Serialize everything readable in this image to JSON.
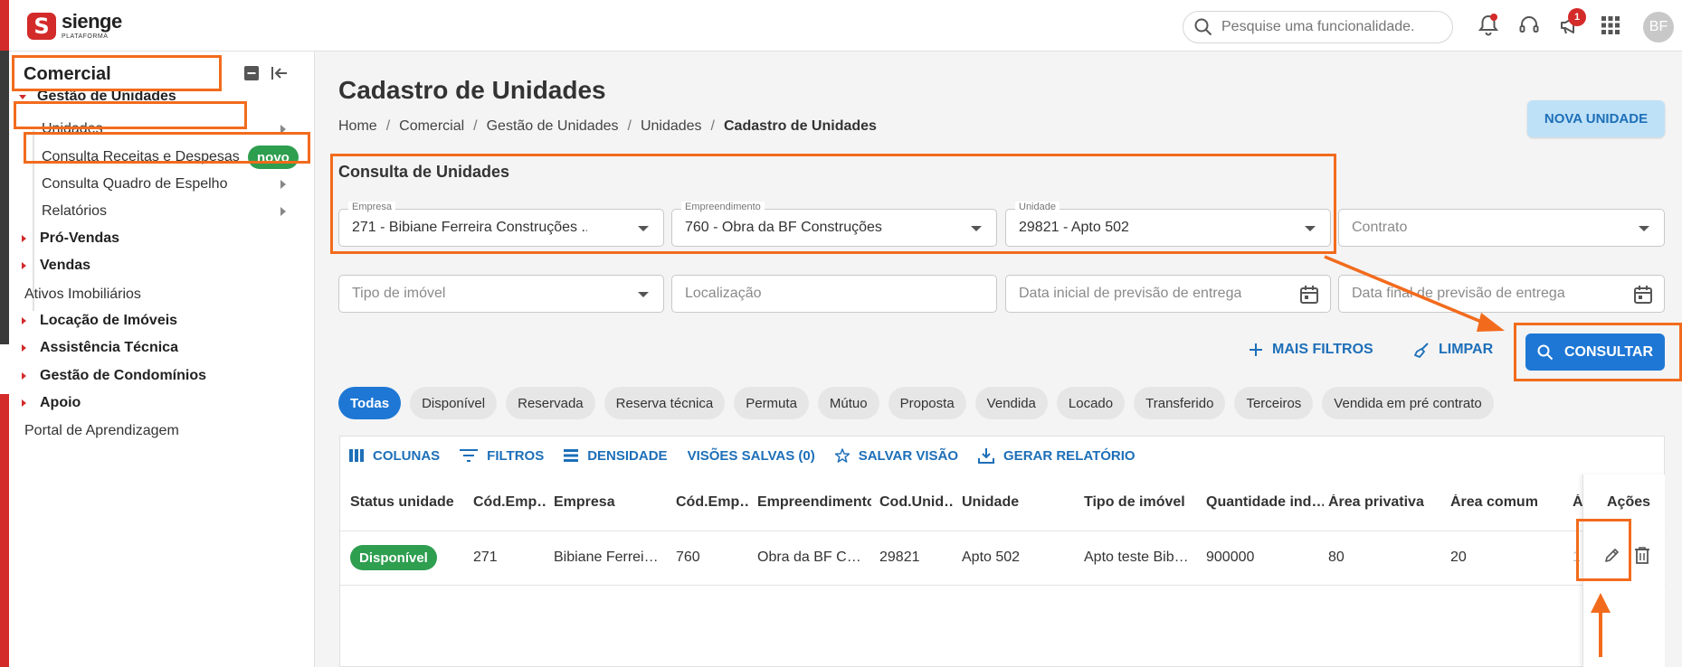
{
  "app": {
    "logo_name": "sienge",
    "logo_sub": "PLATAFORMA",
    "logo_mark": "S"
  },
  "topbar": {
    "search_placeholder": "Pesquise uma funcionalidade.",
    "notifications_badge": "1",
    "avatar_initials": "BF"
  },
  "sidebar": {
    "title": "Comercial",
    "groups": [
      {
        "label": "Gestão de Unidades"
      },
      {
        "label": "Unidades"
      },
      {
        "label": "Consulta Receitas e Despesas",
        "badge": "novo"
      },
      {
        "label": "Consulta Quadro de Espelho"
      },
      {
        "label": "Relatórios"
      },
      {
        "label": "Pró-Vendas"
      },
      {
        "label": "Vendas"
      },
      {
        "label": "Ativos Imobiliários"
      },
      {
        "label": "Locação de Imóveis"
      },
      {
        "label": "Assistência Técnica"
      },
      {
        "label": "Gestão de Condomínios"
      },
      {
        "label": "Apoio"
      },
      {
        "label": "Portal de Aprendizagem"
      }
    ]
  },
  "page": {
    "title": "Cadastro de Unidades",
    "breadcrumb": [
      "Home",
      "Comercial",
      "Gestão de Unidades",
      "Unidades",
      "Cadastro de Unidades"
    ],
    "new_button": "NOVA UNIDADE",
    "section_title": "Consulta de Unidades"
  },
  "filters": {
    "empresa_label": "Empresa",
    "empresa_value": "271 - Bibiane Ferreira Construções ...",
    "empreendimento_label": "Empreendimento",
    "empreendimento_value": "760 - Obra da BF Construções",
    "unidade_label": "Unidade",
    "unidade_value": "29821 - Apto 502",
    "contrato_placeholder": "Contrato",
    "tipo_placeholder": "Tipo de imóvel",
    "localizacao_placeholder": "Localização",
    "data_inicial_placeholder": "Data inicial de previsão de entrega",
    "data_final_placeholder": "Data final de previsão de entrega",
    "mais_filtros": "MAIS FILTROS",
    "limpar": "LIMPAR",
    "consultar": "CONSULTAR"
  },
  "chips": [
    "Todas",
    "Disponível",
    "Reservada",
    "Reserva técnica",
    "Permuta",
    "Mútuo",
    "Proposta",
    "Vendida",
    "Locado",
    "Transferido",
    "Terceiros",
    "Vendida em pré contrato"
  ],
  "grid_toolbar": {
    "colunas": "COLUNAS",
    "filtros": "FILTROS",
    "densidade": "DENSIDADE",
    "visoes": "VISÕES SALVAS (0)",
    "salvar": "SALVAR VISÃO",
    "relatorio": "GERAR RELATÓRIO"
  },
  "table": {
    "headers": [
      "Status unidade",
      "Cód.Emp…",
      "Empresa",
      "Cód.Emp…",
      "Empreendimento",
      "Cod.Unid…",
      "Unidade",
      "Tipo de imóvel",
      "Quantidade ind…",
      "Área privativa",
      "Área comum",
      "Á",
      "Ações"
    ],
    "row": [
      "Disponível",
      "271",
      "Bibiane Ferrei…",
      "760",
      "Obra da BF C…",
      "29821",
      "Apto 502",
      "Apto teste Bib…",
      "900000",
      "80",
      "20",
      "1"
    ]
  },
  "colors": {
    "brand_red": "#d32a2a",
    "primary_blue": "#1e77d4",
    "annotation_orange": "#f26b1d",
    "status_green": "#2e9e4f"
  }
}
